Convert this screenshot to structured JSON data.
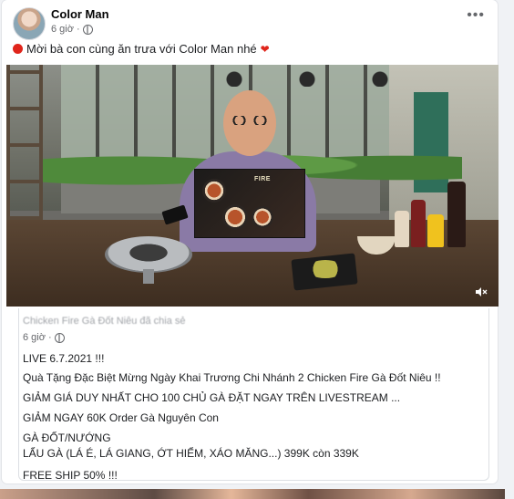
{
  "post": {
    "author": "Color Man",
    "time": "6 giờ",
    "more_label": "•••",
    "caption": "Mời bà con cùng ăn trưa với Color Man nhé",
    "heart": "❤"
  },
  "photo": {
    "menu_label": "FIRE",
    "sound_icon": "speaker-muted-icon"
  },
  "shared": {
    "header_blurred": "Chicken Fire Gà Đốt Niêu đã chia sẻ",
    "time": "6 giờ",
    "lines": [
      "LIVE 6.7.2021 !!!",
      "Quà Tặng Đặc Biệt Mừng Ngày Khai Trương Chi Nhánh 2 Chicken Fire Gà Đốt Niêu !!",
      "GIẢM GIÁ DUY NHẤT CHO 100 CHỦ GÀ ĐẶT NGAY TRÊN LIVESTREAM ...",
      "GIẢM NGAY 60K Order Gà Nguyên Con",
      "GÀ ĐỐT/NƯỚNG",
      "LẨU GÀ (LÁ É, LÁ GIANG, ỚT HIỂM, XÁO MĂNG...) 399K còn 339K",
      "FREE SHIP 50% !!!"
    ]
  },
  "colors": {
    "accent_red": "#e0251b",
    "meta_gray": "#65676b",
    "card_bg": "#ffffff"
  }
}
